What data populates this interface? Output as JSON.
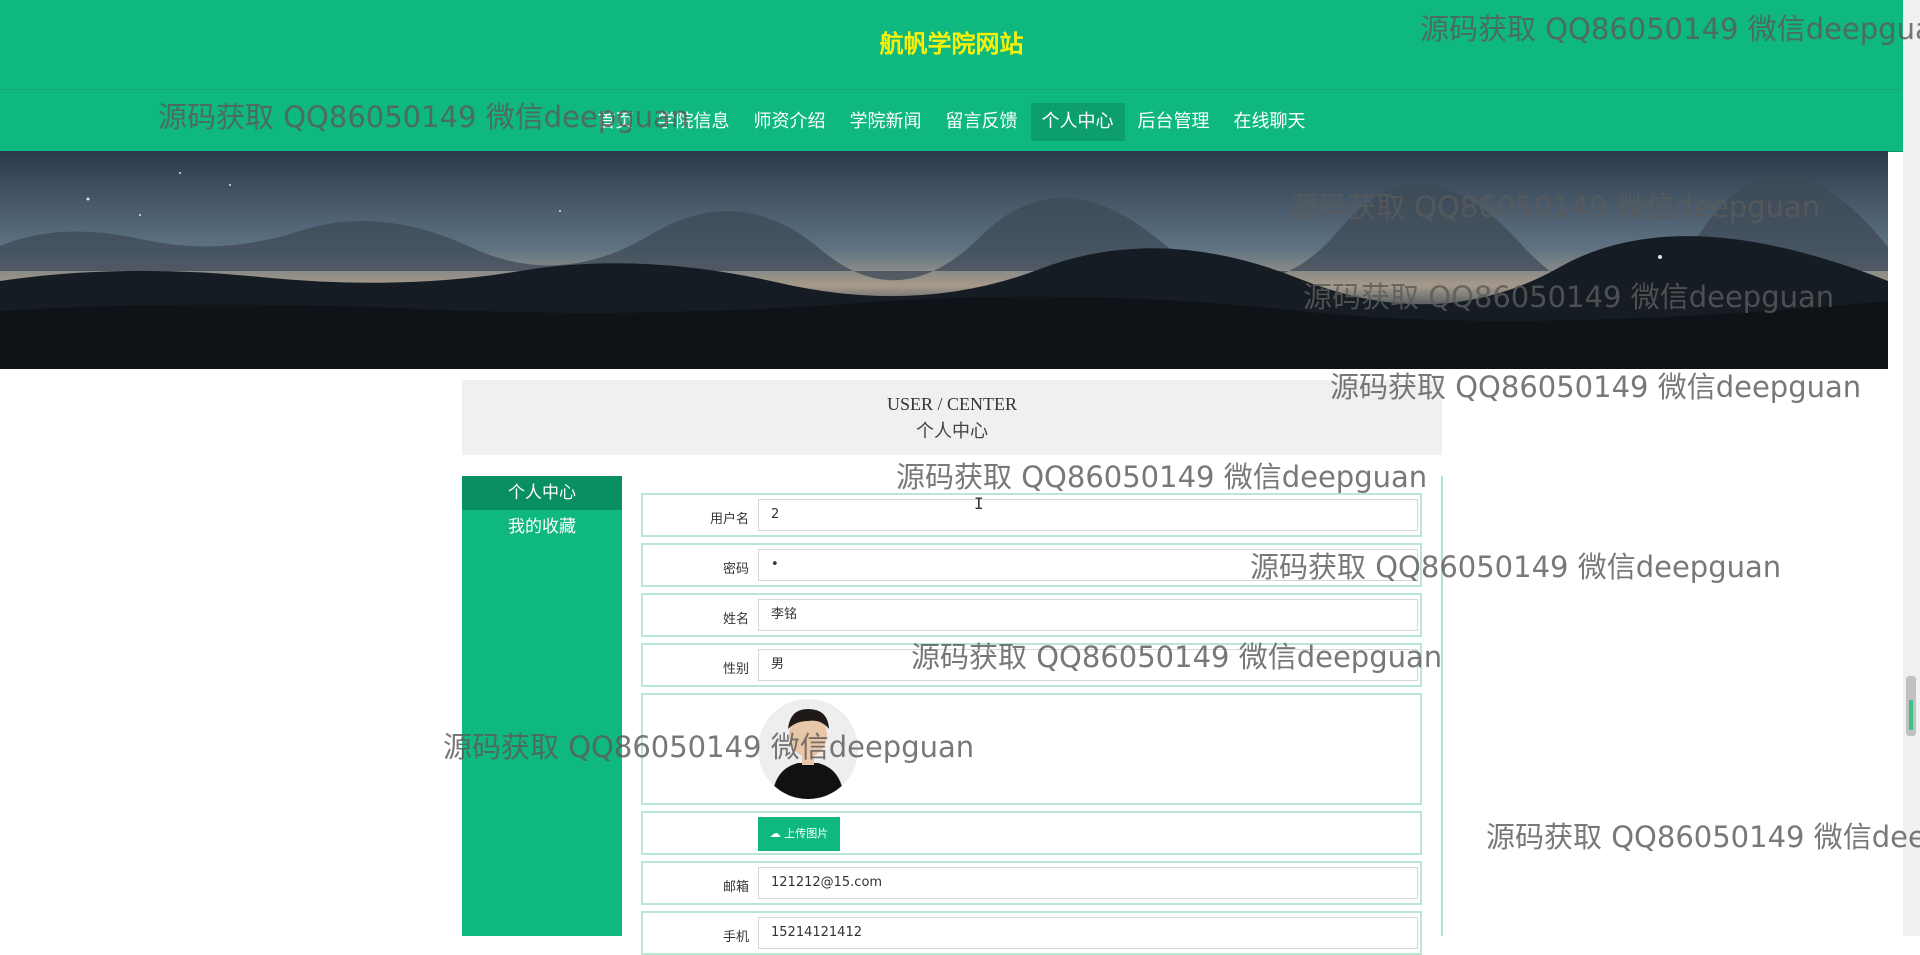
{
  "header": {
    "site_title": "航帆学院网站",
    "nav": [
      {
        "label": "首页",
        "active": false
      },
      {
        "label": "学院信息",
        "active": false
      },
      {
        "label": "师资介绍",
        "active": false
      },
      {
        "label": "学院新闻",
        "active": false
      },
      {
        "label": "留言反馈",
        "active": false
      },
      {
        "label": "个人中心",
        "active": true
      },
      {
        "label": "后台管理",
        "active": false
      },
      {
        "label": "在线聊天",
        "active": false
      }
    ]
  },
  "section": {
    "title_en": "USER / CENTER",
    "title_cn": "个人中心"
  },
  "sidebar": {
    "items": [
      {
        "label": "个人中心",
        "active": true
      },
      {
        "label": "我的收藏",
        "active": false
      }
    ]
  },
  "form": {
    "username_label": "用户名",
    "username_value": "2",
    "password_label": "密码",
    "password_value": "•",
    "name_label": "姓名",
    "name_value": "李铭",
    "gender_label": "性别",
    "gender_value": "男",
    "upload_label": "上传图片",
    "email_label": "邮箱",
    "email_value": "121212@15.com",
    "phone_label": "手机",
    "phone_value": "15214121412"
  },
  "icons": {
    "upload": "cloud-upload-icon"
  },
  "watermark": "源码获取 QQ86050149 微信deepguan",
  "colors": {
    "primary": "#0fb87f",
    "title": "#f7f10a",
    "active_nav": "#0c9f6d"
  }
}
